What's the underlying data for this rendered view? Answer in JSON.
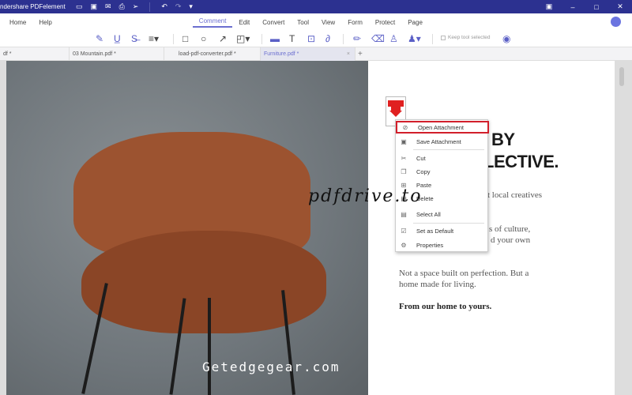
{
  "app": {
    "title": "ndershare PDFelement"
  },
  "menu": {
    "items": [
      "Home",
      "Help",
      "Comment",
      "Edit",
      "Convert",
      "Tool",
      "View",
      "Form",
      "Protect",
      "Page"
    ],
    "active": "Comment"
  },
  "toolbar": {
    "keep_tool_selected": "Keep tool selected"
  },
  "tabs": [
    {
      "label": "df *"
    },
    {
      "label": "03 Mountain.pdf *"
    },
    {
      "label": "load-pdf-converter.pdf *"
    },
    {
      "label": "Furniture.pdf *",
      "active": true
    }
  ],
  "document": {
    "heading1": "BY",
    "heading2": "LECTIVE.",
    "para1": "t local creatives",
    "para2a": "s of culture,",
    "para2b": "d your own",
    "para3": "Not a space built on perfection. But a home made for living.",
    "para4": "From our home to yours."
  },
  "context_menu": {
    "items": [
      "Open Attachment",
      "Save Attachment",
      "Cut",
      "Copy",
      "Paste",
      "Delete",
      "Select All",
      "Set as Default",
      "Properties"
    ],
    "highlighted": "Open Attachment"
  },
  "watermarks": [
    "pdfdrive.to",
    "Getedgegear.com"
  ],
  "colors": {
    "titlebar": "#2c3190",
    "accent": "#6b6fd0",
    "highlight": "#d21f2b"
  }
}
